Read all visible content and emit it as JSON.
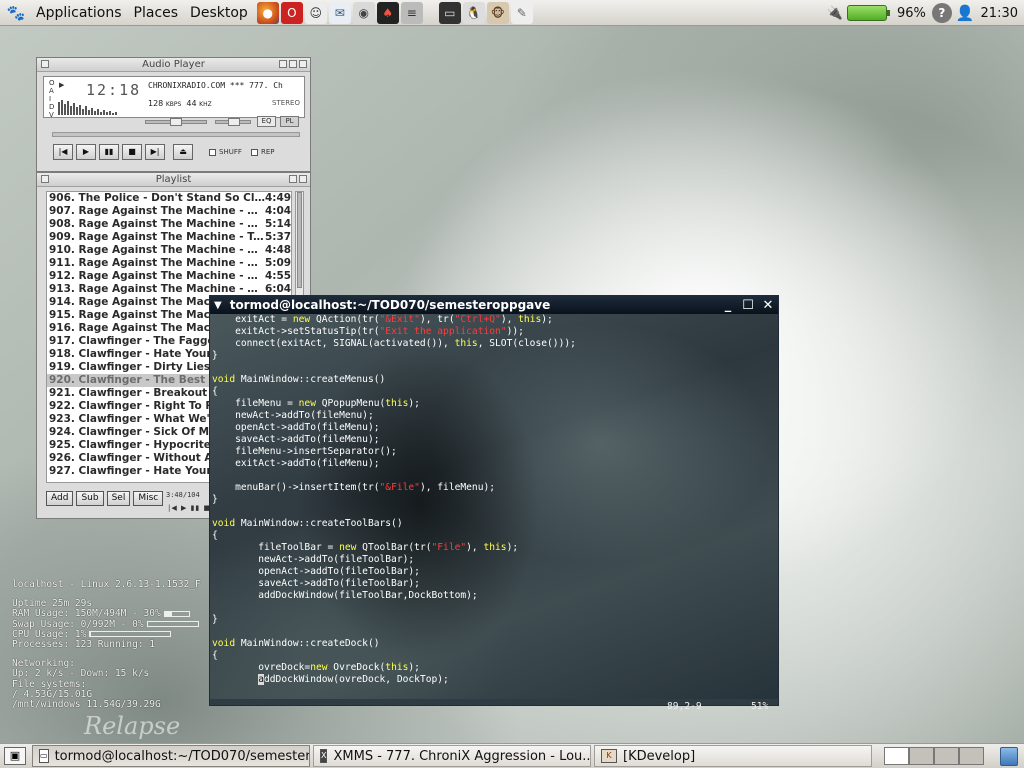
{
  "top_panel": {
    "menus": [
      "Applications",
      "Places",
      "Desktop"
    ],
    "launchers": [
      "firefox-icon",
      "opera-icon",
      "gaim-icon",
      "email-icon",
      "disk-icon",
      "solitaire-icon",
      "database-icon",
      "terminal-icon",
      "penguin-icon",
      "gnome-icon",
      "notes-icon"
    ],
    "battery_percent": "96%",
    "battery_level": 0.96,
    "clock": "21:30"
  },
  "audio_player": {
    "title": "Audio Player",
    "oaidv": [
      "O",
      "A",
      "I",
      "D",
      "V"
    ],
    "time": "12:18",
    "scroll_text": "CHRONIXRADIO.COM *** 777. Ch",
    "kbps": "128",
    "kbps_unit": "KBPS",
    "khz": "44",
    "khz_unit": "KHZ",
    "stereo": "STEREO",
    "eq_label": "EQ",
    "pl_label": "PL",
    "shuffle_label": "SHUFF",
    "repeat_label": "REP"
  },
  "playlist": {
    "title": "Playlist",
    "rows": [
      {
        "title": "906. The Police - Don't Stand So Close To...",
        "dur": "4:49"
      },
      {
        "title": "907. Rage Against The Machine - Bombt...",
        "dur": "4:04"
      },
      {
        "title": "908. Rage Against The Machine - Killing I...",
        "dur": "5:14"
      },
      {
        "title": "909. Rage Against The Machine - Take T...",
        "dur": "5:37"
      },
      {
        "title": "910. Rage Against The Machine - Settle F...",
        "dur": "4:48"
      },
      {
        "title": "911. Rage Against The Machine - Bullet I...",
        "dur": "5:09"
      },
      {
        "title": "912. Rage Against The Machine - Know Y...",
        "dur": "4:55"
      },
      {
        "title": "913. Rage Against The Machine - Wake Up",
        "dur": "6:04"
      },
      {
        "title": "914. Rage Against The Machine",
        "dur": ""
      },
      {
        "title": "915. Rage Against The Machine",
        "dur": ""
      },
      {
        "title": "916. Rage Against The Machine",
        "dur": ""
      },
      {
        "title": "917. Clawfinger - The Faggot In",
        "dur": ""
      },
      {
        "title": "918. Clawfinger - Hate Yourself",
        "dur": ""
      },
      {
        "title": "919. Clawfinger - Dirty Lies",
        "dur": ""
      },
      {
        "title": "920. Clawfinger - The Best & Th",
        "dur": ""
      },
      {
        "title": "921. Clawfinger - Breakout (Emb",
        "dur": ""
      },
      {
        "title": "922. Clawfinger - Right To Rape",
        "dur": ""
      },
      {
        "title": "923. Clawfinger - What We've G",
        "dur": ""
      },
      {
        "title": "924. Clawfinger - Sick Of Myself",
        "dur": ""
      },
      {
        "title": "925. Clawfinger - Hypocrite",
        "dur": ""
      },
      {
        "title": "926. Clawfinger - Without A Cas",
        "dur": ""
      },
      {
        "title": "927. Clawfinger - Hate Yourself",
        "dur": ""
      }
    ],
    "selected_index": 14,
    "buttons": [
      "Add",
      "Sub",
      "Sel",
      "Misc"
    ],
    "info": "3:48/104",
    "mini_controls": "|◀ ▶ ▮▮ ■ ▶|"
  },
  "sysmon": {
    "host_line": "localhost - Linux 2.6.13-1.1532_F",
    "uptime": "Uptime 25m 29s",
    "ram": "RAM Usage: 150M/494M - 30%",
    "ram_level": 0.3,
    "swap": "Swap Usage: 0/992M - 0%",
    "swap_level": 0.0,
    "cpu": "CPU Usage: 1%",
    "cpu_level": 0.01,
    "processes": "Processes: 123  Running: 1",
    "networking": "Networking:",
    "net_speed": " Up: 2 k/s - Down: 15 k/s",
    "fs_header": "File systems:",
    "fs_root": " / 4.53G/15.01G",
    "fs_windows": " /mnt/windows 11.54G/39.29G",
    "watermark": "Relapse"
  },
  "terminal": {
    "title": "tormod@localhost:~/TOD070/semesteroppgave",
    "status_pos": "89,2-9",
    "status_pct": "51%"
  },
  "bottom_panel": {
    "tasks": [
      {
        "label": "tormod@localhost:~/TOD070/semestero...",
        "icon": "terminal-icon"
      },
      {
        "label": "XMMS - 777.  ChroniX Aggression - Lou...",
        "icon": "xmms-icon"
      },
      {
        "label": "[KDevelop]",
        "icon": "kdevelop-icon"
      }
    ]
  }
}
